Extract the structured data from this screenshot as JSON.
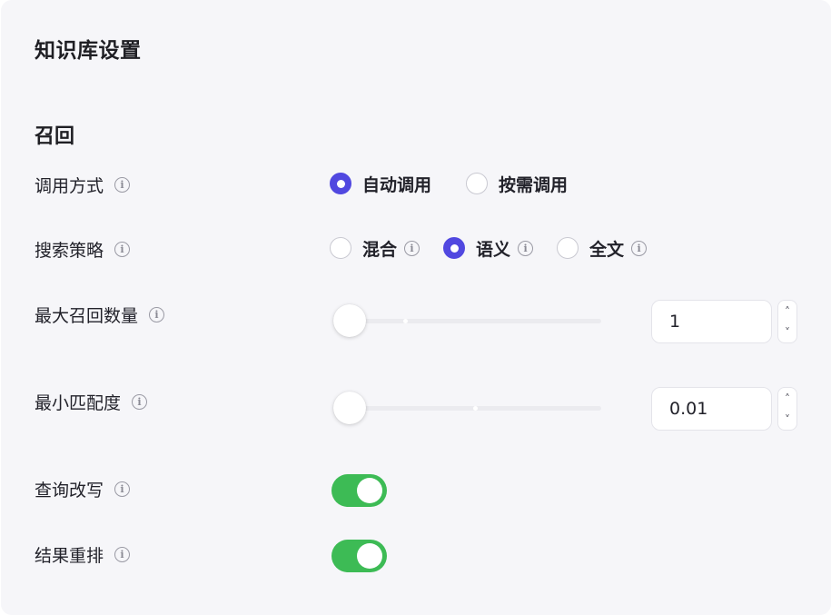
{
  "title": "知识库设置",
  "section_title": "召回",
  "info_glyph": "i",
  "rows": {
    "invoke_mode": {
      "label": "调用方式",
      "options": [
        {
          "label": "自动调用",
          "checked": true
        },
        {
          "label": "按需调用",
          "checked": false
        }
      ]
    },
    "search_strategy": {
      "label": "搜索策略",
      "options": [
        {
          "label": "混合",
          "checked": false
        },
        {
          "label": "语义",
          "checked": true
        },
        {
          "label": "全文",
          "checked": false
        }
      ]
    },
    "max_recall": {
      "label": "最大召回数量",
      "value": "1",
      "stepper_up": "˄",
      "stepper_down": "˅"
    },
    "min_match": {
      "label": "最小匹配度",
      "value": "0.01",
      "stepper_up": "˄",
      "stepper_down": "˅"
    },
    "query_rewrite": {
      "label": "查询改写",
      "enabled": true
    },
    "rerank": {
      "label": "结果重排",
      "enabled": true
    }
  },
  "colors": {
    "accent": "#5148e0",
    "toggle_on": "#3dbb55",
    "panel_bg": "#f6f6f9"
  }
}
